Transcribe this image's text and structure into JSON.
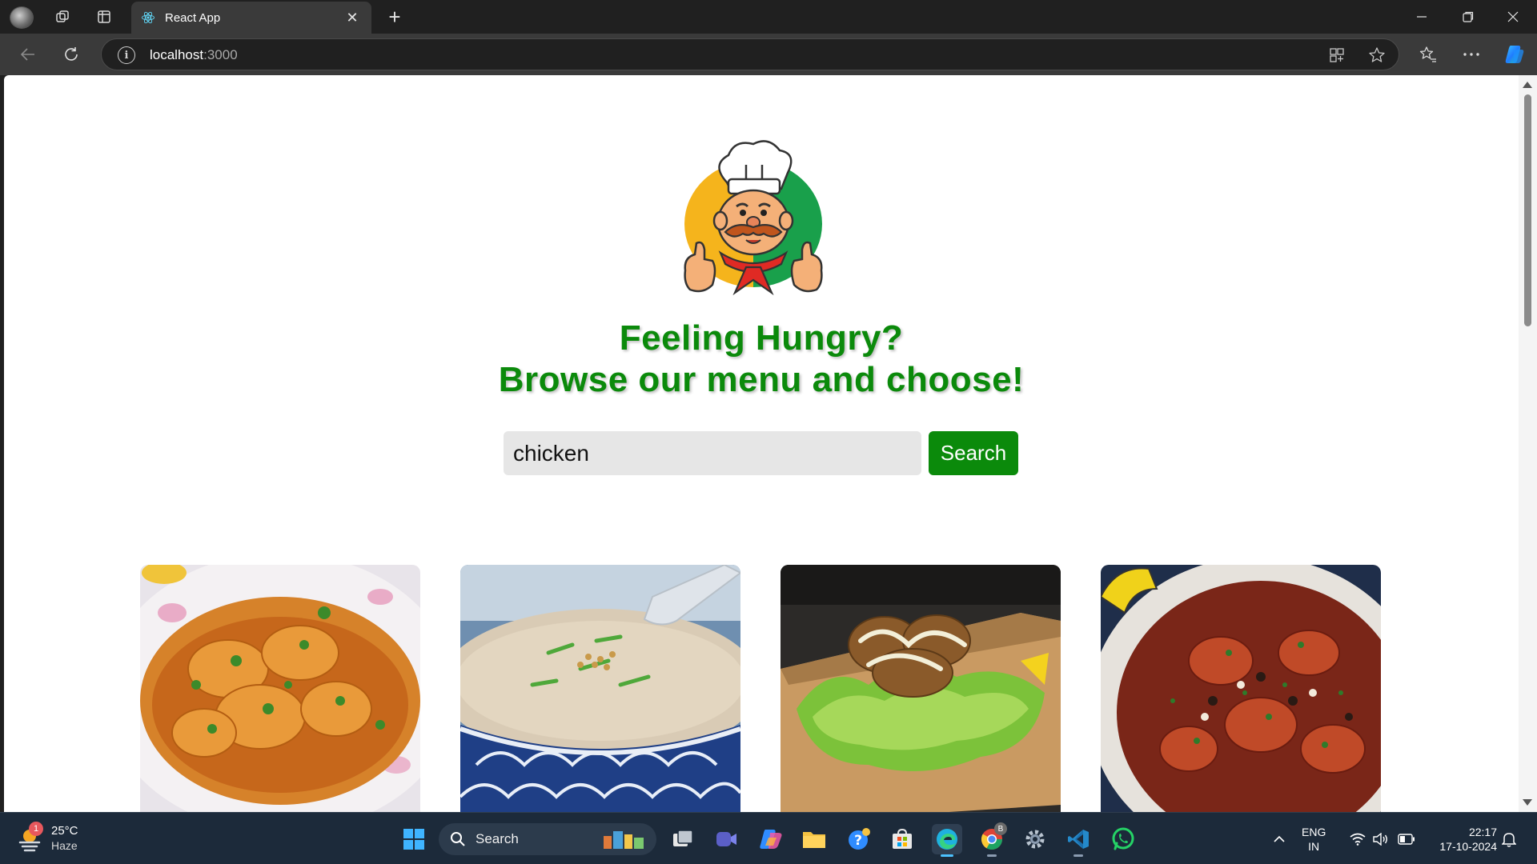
{
  "browser": {
    "tab_title": "React App",
    "url_host": "localhost",
    "url_port": ":3000"
  },
  "page": {
    "headline_line1": "Feeling Hungry?",
    "headline_line2": "Browse our menu and choose!",
    "search_value": "chicken",
    "search_button": "Search",
    "recipe_cards": [
      {
        "icon": "chicken-curry-image"
      },
      {
        "icon": "rice-porridge-image"
      },
      {
        "icon": "fried-chicken-lettuce-image"
      },
      {
        "icon": "chicken-stew-pot-image"
      }
    ]
  },
  "taskbar": {
    "weather_temp": "25°C",
    "weather_condition": "Haze",
    "weather_badge": "1",
    "search_label": "Search",
    "chrome_badge": "B",
    "lang_line1": "ENG",
    "lang_line2": "IN",
    "time": "22:17",
    "date": "17-10-2024"
  },
  "colors": {
    "accent_green": "#0b8a0b",
    "browser_dark": "#202020",
    "taskbar": "#1c2a3a"
  }
}
